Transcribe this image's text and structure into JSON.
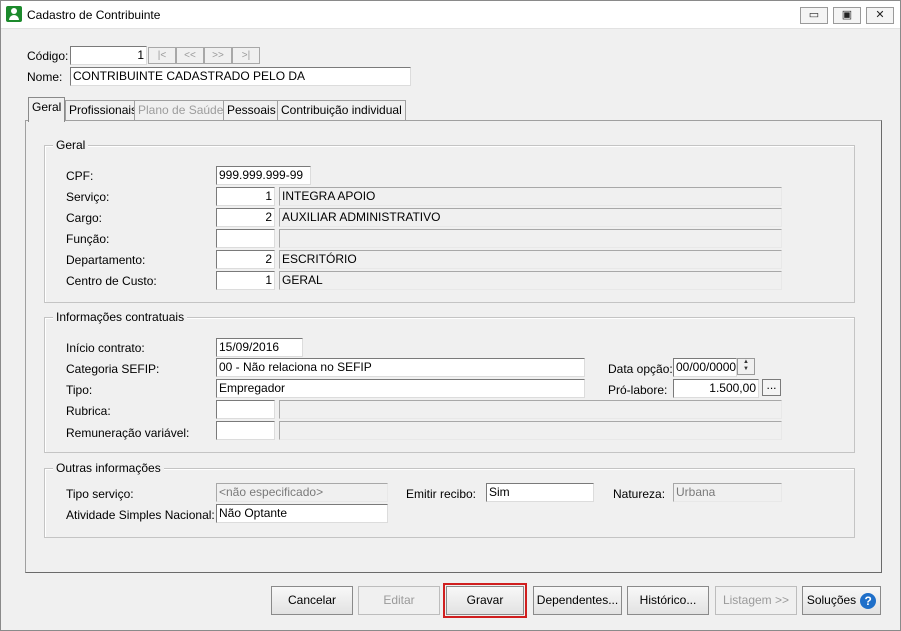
{
  "window": {
    "title": "Cadastro de Contribuinte",
    "minimize": "▭",
    "maximize": "▣",
    "close": "✕"
  },
  "record": {
    "codigo_label": "Código:",
    "codigo_value": "1",
    "nav": [
      "|<",
      "<<",
      ">>",
      ">|"
    ],
    "nome_label": "Nome:",
    "nome_value": "CONTRIBUINTE CADASTRADO PELO DA"
  },
  "tabs": [
    {
      "label": "Geral",
      "active": true,
      "enabled": true
    },
    {
      "label": "Profissionais",
      "active": false,
      "enabled": true
    },
    {
      "label": "Plano de Saúde",
      "active": false,
      "enabled": false
    },
    {
      "label": "Pessoais",
      "active": false,
      "enabled": true
    },
    {
      "label": "Contribuição individual",
      "active": false,
      "enabled": true
    }
  ],
  "geral": {
    "title": "Geral",
    "cpf_label": "CPF:",
    "cpf_value": "999.999.999-99",
    "servico_label": "Serviço:",
    "servico_code": "1",
    "servico_desc": "INTEGRA APOIO",
    "cargo_label": "Cargo:",
    "cargo_code": "2",
    "cargo_desc": "AUXILIAR ADMINISTRATIVO",
    "funcao_label": "Função:",
    "funcao_code": "",
    "funcao_desc": "",
    "departamento_label": "Departamento:",
    "departamento_code": "2",
    "departamento_desc": "ESCRITÓRIO",
    "centro_label": "Centro de Custo:",
    "centro_code": "1",
    "centro_desc": "GERAL"
  },
  "contratuais": {
    "title": "Informações contratuais",
    "inicio_label": "Início contrato:",
    "inicio_value": "15/09/2016",
    "categoria_label": "Categoria SEFIP:",
    "categoria_value": "00 - Não relaciona no SEFIP",
    "data_opcao_label": "Data opção:",
    "data_opcao_value": "00/00/0000",
    "tipo_label": "Tipo:",
    "tipo_value": "Empregador",
    "pro_labore_label": "Pró-labore:",
    "pro_labore_value": "1.500,00",
    "ellipsis": "...",
    "rubrica_label": "Rubrica:",
    "remuneracao_label": "Remuneração variável:"
  },
  "outras": {
    "title": "Outras informações",
    "tipo_servico_label": "Tipo serviço:",
    "tipo_servico_value": "<não especificado>",
    "emitir_label": "Emitir recibo:",
    "emitir_value": "Sim",
    "natureza_label": "Natureza:",
    "natureza_value": "Urbana",
    "atividade_label": "Atividade Simples Nacional:",
    "atividade_value": "Não Optante"
  },
  "buttons": {
    "cancelar": "Cancelar",
    "editar": "Editar",
    "gravar": "Gravar",
    "dependentes": "Dependentes...",
    "historico": "Histórico...",
    "listagem": "Listagem >>",
    "solucoes": "Soluções",
    "help": "?"
  }
}
